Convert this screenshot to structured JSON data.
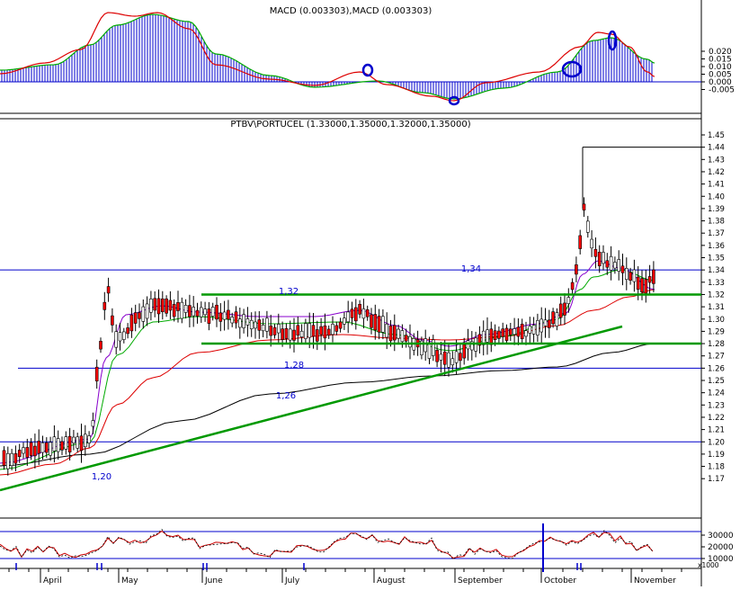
{
  "macd_panel": {
    "title": "MACD (0.003303),MACD (0.003303)",
    "axis_ticks": [
      "0.020",
      "0.015",
      "0.010",
      "0.005",
      "0.000",
      "-0.005"
    ]
  },
  "price_panel": {
    "title": "PTBV\\PORTUCEL (1.33000,1.35000,1.32000,1.35000)",
    "axis_ticks": [
      "1.45",
      "1.44",
      "1.43",
      "1.42",
      "1.41",
      "1.40",
      "1.39",
      "1.38",
      "1.37",
      "1.36",
      "1.35",
      "1.34",
      "1.33",
      "1.32",
      "1.31",
      "1.30",
      "1.29",
      "1.28",
      "1.27",
      "1.26",
      "1.25",
      "1.24",
      "1.23",
      "1.22",
      "1.21",
      "1.20",
      "1.19",
      "1.18",
      "1.17"
    ],
    "level_labels": [
      "1,34",
      "1,32",
      "1,28",
      "1,26",
      "1,20"
    ]
  },
  "volume_panel": {
    "axis_ticks": [
      "30000",
      "20000",
      "10000"
    ],
    "unit": "x1000"
  },
  "months": [
    "April",
    "May",
    "June",
    "July",
    "August",
    "September",
    "October",
    "November"
  ],
  "colors": {
    "axis_text": "#000000",
    "grid": "#000000",
    "level_line": "#0000cc",
    "support_line": "#009900",
    "ma_black": "#000000",
    "ma_red": "#dd0000",
    "ma_green": "#00aa00",
    "ma_purple": "#8800cc",
    "macd_bar": "#0000cc",
    "marker": "#0000cc",
    "candle_down": "#ff0000",
    "candle_up": "#ffffff"
  },
  "chart_data": [
    {
      "type": "bar",
      "panel": "MACD",
      "title": "MACD (0.003303),MACD (0.003303)",
      "ylim": [
        -0.008,
        0.024
      ],
      "key_points": [
        {
          "month": "April",
          "value": 0.004
        },
        {
          "month": "May",
          "value": 0.021
        },
        {
          "month": "June",
          "value": 0.01
        },
        {
          "month": "July",
          "value": 0.001
        },
        {
          "month": "August",
          "value": 0.003
        },
        {
          "month": "September",
          "value": -0.006
        },
        {
          "month": "October",
          "value": 0.004
        },
        {
          "month": "October",
          "value": 0.015
        },
        {
          "month": "November",
          "value": 0.006
        }
      ]
    },
    {
      "type": "candlestick",
      "panel": "price",
      "title": "PTBV\\PORTUCEL (1.33000,1.35000,1.32000,1.35000)",
      "last": {
        "open": 1.33,
        "high": 1.35,
        "low": 1.32,
        "close": 1.35
      },
      "ylim": [
        1.165,
        1.455
      ],
      "levels": [
        1.34,
        1.32,
        1.28,
        1.26,
        1.2,
        1.44
      ],
      "trend_support": [
        {
          "month": "April",
          "value": 1.19
        },
        {
          "month": "October",
          "value": 1.3
        }
      ],
      "moving_averages": [
        "black",
        "red",
        "green",
        "purple"
      ],
      "key_closes": [
        {
          "month": "April",
          "value": 1.21
        },
        {
          "month": "May",
          "value": 1.31
        },
        {
          "month": "June",
          "value": 1.31
        },
        {
          "month": "July",
          "value": 1.3
        },
        {
          "month": "August",
          "value": 1.28
        },
        {
          "month": "September",
          "value": 1.3
        },
        {
          "month": "October",
          "value": 1.39
        },
        {
          "month": "November",
          "value": 1.35
        }
      ]
    },
    {
      "type": "line",
      "panel": "volume",
      "unit": "x1000",
      "ylim": [
        5000,
        35000
      ]
    }
  ]
}
